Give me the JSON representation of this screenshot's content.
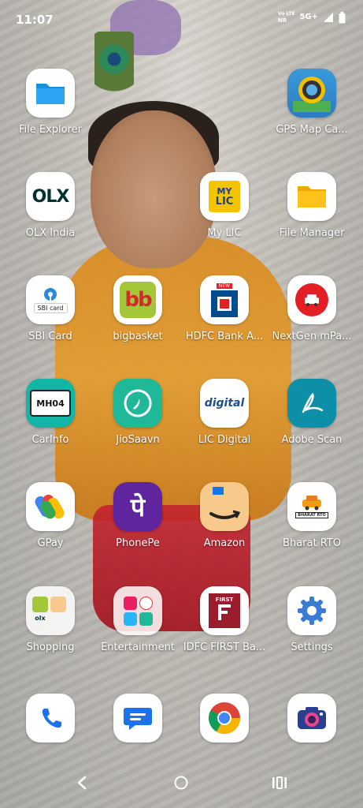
{
  "status": {
    "time": "11:07",
    "volte_top": "Vo LTE",
    "volte_bottom": "NR",
    "network": "5G+"
  },
  "apps": [
    {
      "label": "File Explorer",
      "icon": "folder-icon"
    },
    {
      "label": "GPS Map Ca...",
      "icon": "gps-camera-icon"
    },
    {
      "label": "OLX India",
      "icon": "olx-icon"
    },
    {
      "label": "My LIC",
      "icon": "my-lic-icon"
    },
    {
      "label": "File Manager",
      "icon": "file-manager-icon"
    },
    {
      "label": "SBI Card",
      "icon": "sbi-card-icon"
    },
    {
      "label": "bigbasket",
      "icon": "bigbasket-icon"
    },
    {
      "label": "HDFC Bank A...",
      "icon": "hdfc-icon"
    },
    {
      "label": "NextGen mPa...",
      "icon": "nextgen-icon"
    },
    {
      "label": "CarInfo",
      "icon": "carinfo-icon"
    },
    {
      "label": "JioSaavn",
      "icon": "jiosaavn-icon"
    },
    {
      "label": "LIC Digital",
      "icon": "lic-digital-icon"
    },
    {
      "label": "Adobe Scan",
      "icon": "adobe-scan-icon"
    },
    {
      "label": "GPay",
      "icon": "gpay-icon"
    },
    {
      "label": "PhonePe",
      "icon": "phonepe-icon"
    },
    {
      "label": "Amazon",
      "icon": "amazon-icon"
    },
    {
      "label": "Bharat RTO",
      "icon": "bharat-rto-icon"
    },
    {
      "label": "Shopping",
      "icon": "folder-shopping-icon"
    },
    {
      "label": "Entertainment",
      "icon": "folder-entertainment-icon"
    },
    {
      "label": "IDFC FIRST Ba...",
      "icon": "idfc-icon"
    },
    {
      "label": "Settings",
      "icon": "settings-icon"
    }
  ],
  "icon_text": {
    "olx": "OLX",
    "my_lic_top": "MY",
    "my_lic_bottom": "LIC",
    "sbi": "SBI card",
    "bb": "bb",
    "carinfo_plate": "MH04",
    "lic_digital": "digital",
    "phonepe": "पे",
    "rto_plate": "BHARAT RTO",
    "idfc": "FIRST",
    "shopping_olx": "olx",
    "hdfc_new": "NEW"
  },
  "dock": [
    {
      "icon": "phone-icon"
    },
    {
      "icon": "messages-icon"
    },
    {
      "icon": "chrome-icon"
    },
    {
      "icon": "camera-icon"
    }
  ]
}
